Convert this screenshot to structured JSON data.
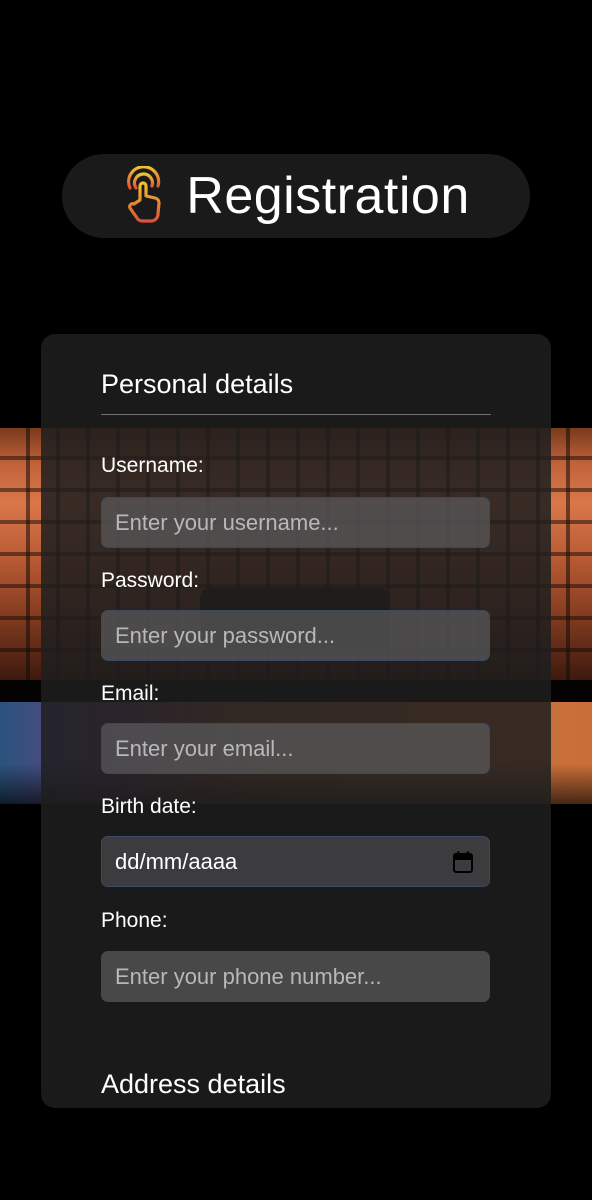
{
  "header": {
    "title": "Registration",
    "icon": "tap-hand-icon"
  },
  "personal": {
    "section_title": "Personal details",
    "fields": [
      {
        "label": "Username:",
        "placeholder": "Enter your username..."
      },
      {
        "label": "Password:",
        "placeholder": "Enter your password..."
      },
      {
        "label": "Email:",
        "placeholder": "Enter your email..."
      },
      {
        "label": "Birth date:",
        "value": "dd/mm/aaaa"
      },
      {
        "label": "Phone:",
        "placeholder": "Enter your phone number..."
      }
    ]
  },
  "address": {
    "section_title": "Address details"
  },
  "colors": {
    "background": "#000000",
    "card": "#1e1e1e",
    "icon_gradient_start": "#f2c12e",
    "icon_gradient_end": "#e0513a"
  }
}
